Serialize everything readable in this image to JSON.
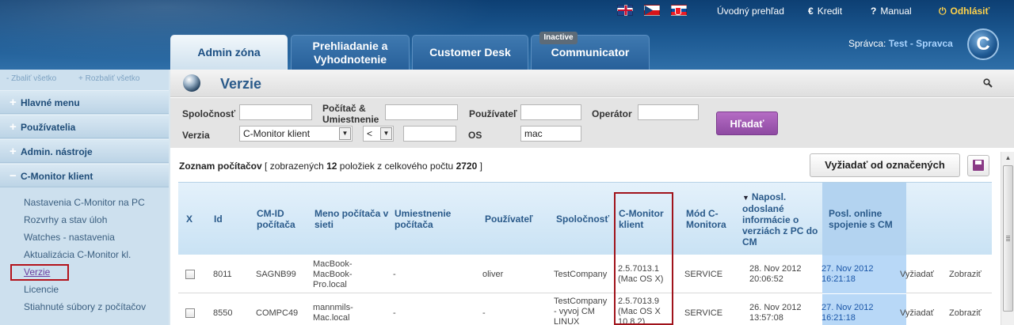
{
  "header": {
    "flags": [
      "flag-uk-icon",
      "flag-cz-icon",
      "flag-sk-icon"
    ],
    "links": {
      "home": "Úvodný prehľad",
      "credit": "Kredit",
      "manual": "Manual",
      "logout": "Odhlásiť"
    },
    "icons": {
      "credit": "€",
      "manual": "?",
      "logout": "⏻"
    },
    "tabs": {
      "admin": "Admin zóna",
      "review_line1": "Prehliadanie a",
      "review_line2": "Vyhodnotenie",
      "desk": "Customer Desk",
      "comm": "Communicator",
      "comm_badge": "Inactive"
    },
    "admin_label": "Správca:",
    "admin_name": "Test - Spravca",
    "logo_letter": "C"
  },
  "sidebar": {
    "collapse_all": "- Zbaliť všetko",
    "expand_all": "+ Rozbaliť všetko",
    "sections": [
      {
        "sign": "+",
        "label": "Hlavné menu"
      },
      {
        "sign": "+",
        "label": "Používatelia"
      },
      {
        "sign": "+",
        "label": "Admin. nástroje"
      },
      {
        "sign": "−",
        "label": "C-Monitor klient"
      }
    ],
    "sub_items": [
      "Nastavenia C-Monitor na PC",
      "Rozvrhy a stav úloh",
      "Watches - nastavenia",
      "Aktualizácia C-Monitor kl.",
      "Verzie",
      "Licencie",
      "Stiahnuté súbory z počítačov"
    ]
  },
  "page": {
    "title": "Verzie"
  },
  "filters": {
    "company_label": "Spoločnosť",
    "computer_label_1": "Počítač &",
    "computer_label_2": "Umiestnenie",
    "user_label": "Používateľ",
    "operator_label": "Operátor",
    "version_label": "Verzia",
    "version_value": "C-Monitor klient",
    "compare_value": "<",
    "os_label": "OS",
    "os_value": "mac",
    "search_button": "Hľadať"
  },
  "list": {
    "caption_prefix": "Zoznam počítačov",
    "caption_shown_pre": "[ zobrazených",
    "shown": "12",
    "caption_mid": "položiek z celkového počtu",
    "total": "2720",
    "caption_end": "]",
    "request_button": "Vyžiadať od označených"
  },
  "table": {
    "headers": {
      "x": "X",
      "id": "Id",
      "cmid": "CM-ID počítača",
      "name": "Meno počítača v sieti",
      "location": "Umiestnenie počítača",
      "user": "Používateľ",
      "company": "Spoločnosť",
      "client": "C-Monitor klient",
      "mode": "Mód C-Monitora",
      "lastinfo": "Naposl. odoslané informácie o verziách z PC do CM",
      "online": "Posl. online spojenie s CM"
    },
    "rows": [
      {
        "id": "8011",
        "cmid": "SAGNB99",
        "name": "MacBook-MacBook-Pro.local",
        "location": "-",
        "user": "oliver",
        "company": "TestCompany",
        "client": "2.5.7013.1 (Mac OS X)",
        "mode": "SERVICE",
        "lastinfo": "28. Nov 2012 20:06:52",
        "online": "27. Nov 2012 16:21:18",
        "action1": "Vyžiadať",
        "action2": "Zobraziť"
      },
      {
        "id": "8550",
        "cmid": "COMPC49",
        "name": "mannmils-Mac.local",
        "location": "-",
        "user": "-",
        "company": "TestCompany - vyvoj CM LINUX",
        "client": "2.5.7013.9 (Mac OS X 10.8.2)",
        "mode": "SERVICE",
        "lastinfo": "26. Nov 2012 13:57:08",
        "online": "27. Nov 2012 16:21:18",
        "action1": "Vyžiadať",
        "action2": "Zobraziť"
      }
    ]
  },
  "colors": {
    "accent": "#2a5a8a",
    "highlight_border": "#a0131b",
    "search_button": "#9b55ad",
    "online_cell": "#b8d8f7"
  }
}
